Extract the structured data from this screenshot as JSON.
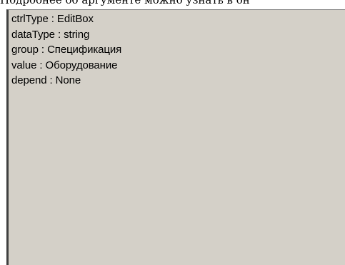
{
  "top_text": "Подробнее об аргументе можно узнать в он",
  "properties": [
    "ctrlType : EditBox",
    "dataType : string",
    "group : Спецификация",
    "value : Оборудование",
    "depend : None"
  ]
}
